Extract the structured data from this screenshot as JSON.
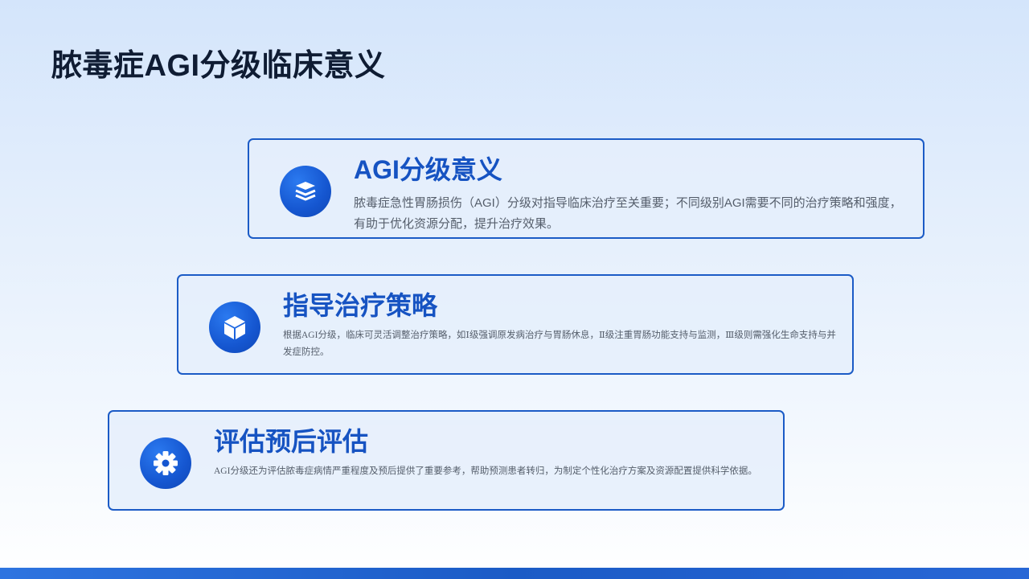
{
  "page": {
    "title": "脓毒症AGI分级临床意义"
  },
  "cards": [
    {
      "icon": "layers-icon",
      "title": "AGI分级意义",
      "description": "脓毒症急性胃肠损伤（AGI）分级对指导临床治疗至关重要；不同级别AGI需要不同的治疗策略和强度，有助于优化资源分配，提升治疗效果。"
    },
    {
      "icon": "cube-icon",
      "title": "指导治疗策略",
      "description": "根据AGI分级，临床可灵活调整治疗策略，如Ⅰ级强调原发病治疗与胃肠休息，Ⅱ级注重胃肠功能支持与监测，Ⅲ级则需强化生命支持与并发症防控。"
    },
    {
      "icon": "gear-icon",
      "title": "评估预后评估",
      "description": "AGI分级还为评估脓毒症病情严重程度及预后提供了重要参考，帮助预测患者转归，为制定个性化治疗方案及资源配置提供科学依据。"
    }
  ],
  "colors": {
    "accent": "#1653c2",
    "title_text": "#0f1c33",
    "body_text": "#555e6b",
    "card_border": "#1b5bc6"
  }
}
